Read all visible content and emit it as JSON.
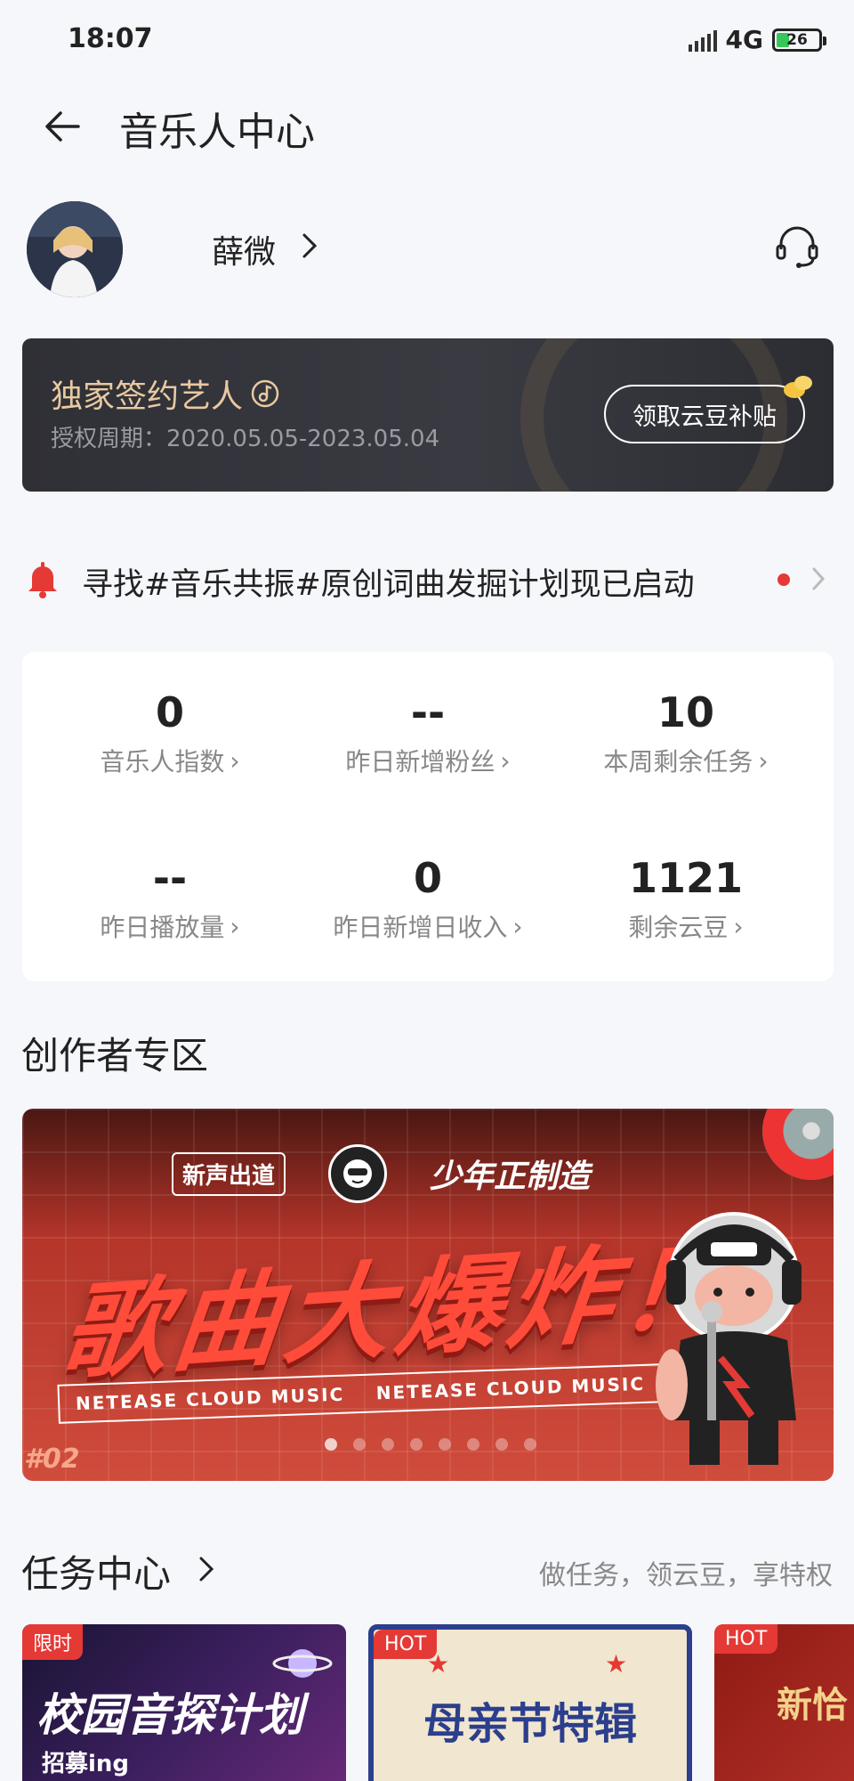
{
  "status_bar": {
    "time": "18:07",
    "network": "4G",
    "battery": "26"
  },
  "header": {
    "title": "音乐人中心"
  },
  "profile": {
    "name": "薛微"
  },
  "sign_card": {
    "title": "独家签约艺人",
    "period": "授权周期：2020.05.05-2023.05.04",
    "button_label": "领取云豆补贴"
  },
  "notice": {
    "text": "寻找#音乐共振#原创词曲发掘计划现已启动"
  },
  "stats": [
    {
      "value": "0",
      "label": "音乐人指数"
    },
    {
      "value": "--",
      "label": "昨日新增粉丝"
    },
    {
      "value": "10",
      "label": "本周剩余任务"
    },
    {
      "value": "--",
      "label": "昨日播放量"
    },
    {
      "value": "0",
      "label": "昨日新增日收入"
    },
    {
      "value": "1121",
      "label": "剩余云豆"
    }
  ],
  "creator_section": {
    "title": "创作者专区"
  },
  "banner": {
    "badge_left": "新声出道",
    "badge_right": "少年正制造",
    "headline": "歌曲大爆炸！",
    "strip_left": "NETEASE CLOUD MUSIC",
    "strip_right": "NETEASE CLOUD MUSIC",
    "tag": "#02"
  },
  "task_center": {
    "title": "任务中心",
    "hint": "做任务，领云豆，享特权",
    "cards": [
      {
        "tag": "限时",
        "name": "校园音探计划",
        "sub": "招募ing"
      },
      {
        "tag": "HOT",
        "name": "母亲节特辑"
      },
      {
        "tag": "HOT",
        "name": "新恰"
      }
    ]
  },
  "colors": {
    "accent_red": "#e53935",
    "card_dark": "#2f3036",
    "gold": "#e9c9a1"
  }
}
